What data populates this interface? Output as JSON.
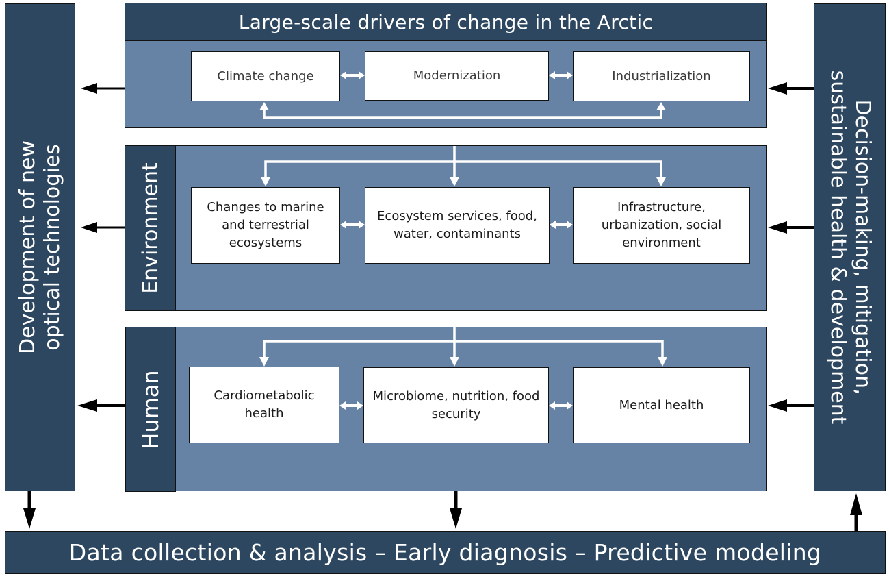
{
  "diagram": {
    "title": "Large-scale drivers of change in the Arctic",
    "drivers": [
      {
        "label": "Climate change"
      },
      {
        "label": "Modernization"
      },
      {
        "label": "Industrialization"
      }
    ],
    "environment": {
      "label": "Environment",
      "boxes": [
        {
          "label": "Changes to marine and terrestrial ecosystems"
        },
        {
          "label": "Ecosystem services, food, water, contaminants"
        },
        {
          "label": "Infrastructure, urbanization, social environment"
        }
      ]
    },
    "human": {
      "label": "Human",
      "boxes": [
        {
          "label": "Cardiometabolic health"
        },
        {
          "label": "Microbiome, nutrition, food security"
        },
        {
          "label": "Mental health"
        }
      ]
    },
    "left_panel": {
      "line1": "Development of new",
      "line2": "optical technologies"
    },
    "right_panel": {
      "line1": "Decision-making, mitigation,",
      "line2": "sustainable health & development"
    },
    "bottom_bar": "Data collection & analysis – Early diagnosis – Predictive modeling",
    "colors": {
      "dark_panel": "#2e4760",
      "mid_panel": "#6682a5",
      "box": "#ffffff",
      "arrow_dark": "#000000",
      "arrow_light": "#ffffff"
    }
  }
}
